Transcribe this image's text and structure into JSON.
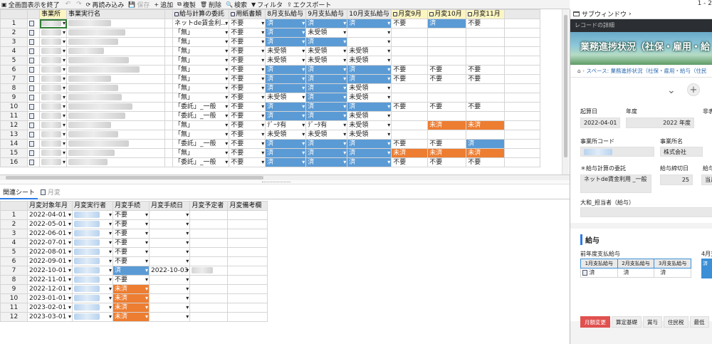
{
  "toolbar": {
    "items": [
      "全画面表示を終了",
      "↶",
      "↷",
      "再読み込み",
      "保存",
      "追加",
      "複製",
      "削除",
      "検索",
      "フィルタ",
      "エクスポート"
    ],
    "page_indicator": "1 - 2"
  },
  "main_grid": {
    "columns": [
      "事業所",
      "事業実行名",
      "",
      "給与計算の委託",
      "用紙書類",
      "8月支払給与",
      "9月支払給与",
      "10月支払給与",
      "月変9月",
      "月変10月",
      "月変11月"
    ],
    "rows": [
      {
        "n": "1",
        "kb": "ネットde賃金利…",
        "y": "不要",
        "a": "済",
        "b": "済",
        "c": "済",
        "d": "不要",
        "e": "済",
        "f": "不要"
      },
      {
        "n": "2",
        "kb": "「無」",
        "y": "不要",
        "a": "済",
        "b": "未受領",
        "c": "",
        "d": "",
        "e": "",
        "f": ""
      },
      {
        "n": "3",
        "kb": "「無」",
        "y": "不要",
        "a": "済",
        "b": "済",
        "c": "",
        "d": "",
        "e": "",
        "f": ""
      },
      {
        "n": "4",
        "kb": "「無」",
        "y": "不要",
        "a": "未受領",
        "b": "未受領",
        "c": "未受領",
        "d": "",
        "e": "",
        "f": ""
      },
      {
        "n": "5",
        "kb": "「無」",
        "y": "不要",
        "a": "未受領",
        "b": "未受領",
        "c": "未受領",
        "d": "",
        "e": "",
        "f": ""
      },
      {
        "n": "6",
        "kb": "「無」",
        "y": "不要",
        "a": "済",
        "b": "済",
        "c": "済",
        "d": "不要",
        "e": "不要",
        "f": "不要"
      },
      {
        "n": "7",
        "kb": "「無」",
        "y": "不要",
        "a": "済",
        "b": "済",
        "c": "済",
        "d": "不要",
        "e": "不要",
        "f": "不要"
      },
      {
        "n": "8",
        "kb": "「無」",
        "y": "不要",
        "a": "済",
        "b": "済",
        "c": "未受領",
        "d": "",
        "e": "",
        "f": ""
      },
      {
        "n": "9",
        "kb": "「無」",
        "y": "不要",
        "a": "未受領",
        "b": "済",
        "c": "未受領",
        "d": "",
        "e": "",
        "f": ""
      },
      {
        "n": "10",
        "kb": "「委託」_一般",
        "y": "不要",
        "a": "済",
        "b": "済",
        "c": "済",
        "d": "不要",
        "e": "不要",
        "f": "不要"
      },
      {
        "n": "11",
        "kb": "「委託」_一般",
        "y": "不要",
        "a": "済",
        "b": "済",
        "c": "未受領",
        "d": "",
        "e": "",
        "f": ""
      },
      {
        "n": "12",
        "kb": "「無」",
        "y": "不要",
        "a": "ﾃﾞｰﾀ有",
        "b": "ﾃﾞｰﾀ有",
        "c": "未受領",
        "d": "",
        "e": "未済",
        "f": "未済"
      },
      {
        "n": "13",
        "kb": "「無」",
        "y": "不要",
        "a": "未受領",
        "b": "未受領",
        "c": "未受領",
        "d": "",
        "e": "",
        "f": ""
      },
      {
        "n": "14",
        "kb": "「委託」_一般",
        "y": "不要",
        "a": "済",
        "b": "済",
        "c": "済",
        "d": "不要",
        "e": "不要",
        "f": "済"
      },
      {
        "n": "15",
        "kb": "「無」",
        "y": "不要",
        "a": "済",
        "b": "済",
        "c": "済",
        "d": "未済",
        "e": "未済",
        "f": "未済"
      },
      {
        "n": "16",
        "kb": "「委託」_一般",
        "y": "不要",
        "a": "済",
        "b": "済",
        "c": "済",
        "d": "不要",
        "e": "不要",
        "f": "不要"
      }
    ]
  },
  "related": {
    "tabs": [
      "関連シート",
      "月変"
    ],
    "columns": [
      "月変対象年月",
      "月変実行者",
      "月変手続",
      "月変手続日",
      "月変予定者",
      "月変備考欄"
    ],
    "rows": [
      {
        "n": "1",
        "ym": "2022-04-01",
        "p": "不要",
        "d": ""
      },
      {
        "n": "2",
        "ym": "2022-05-01",
        "p": "不要",
        "d": ""
      },
      {
        "n": "3",
        "ym": "2022-06-01",
        "p": "不要",
        "d": ""
      },
      {
        "n": "4",
        "ym": "2022-07-01",
        "p": "不要",
        "d": ""
      },
      {
        "n": "5",
        "ym": "2022-08-01",
        "p": "不要",
        "d": ""
      },
      {
        "n": "6",
        "ym": "2022-09-01",
        "p": "不要",
        "d": ""
      },
      {
        "n": "7",
        "ym": "2022-10-01",
        "p": "済",
        "d": "2022-10-03"
      },
      {
        "n": "8",
        "ym": "2022-11-01",
        "p": "不要",
        "d": ""
      },
      {
        "n": "9",
        "ym": "2022-12-01",
        "p": "未済",
        "d": ""
      },
      {
        "n": "10",
        "ym": "2023-01-01",
        "p": "未済",
        "d": ""
      },
      {
        "n": "11",
        "ym": "2023-02-01",
        "p": "未済",
        "d": ""
      },
      {
        "n": "12",
        "ym": "2023-03-01",
        "p": "未済",
        "d": ""
      }
    ]
  },
  "side": {
    "header": "サブウィンドウ",
    "record_detail": "レコードの詳細",
    "banner_title": "業務進捗状況（社保・雇用・給",
    "breadcrumb": "スペース: 業務進捗状況（社保・雇用・給与（住民",
    "fields": {
      "kisanbi_label": "起算日",
      "kisanbi": "2022-04-01",
      "nendo_label": "年度",
      "nendo": "2022 年度",
      "hi_label": "非表",
      "jigyosho_code_label": "事業所コード",
      "jigyosho_mei_label": "事業所名",
      "jigyosho_mei": "株式会社",
      "itaku_label": "＊給与計算の委託",
      "itaku": "ネットde賃金利用 _一般",
      "shimebi_label": "給与締切日",
      "shimebi": "25",
      "kyuyo_label": "給与",
      "kyuyo_value": "当月",
      "tanto_label": "大和_担当者（給与）"
    },
    "section": "給与",
    "prev_label": "前年度支払給与",
    "apr_label": "4月支",
    "pay_table_headers": [
      "1月支払給与",
      "2月支払給与",
      "3月支払給与"
    ],
    "pay_table_values": [
      "済",
      "済",
      "済"
    ],
    "apr_value": "済",
    "bottom_tabs": [
      "月額変更",
      "算定基礎",
      "賞与",
      "住民税",
      "最低"
    ]
  }
}
